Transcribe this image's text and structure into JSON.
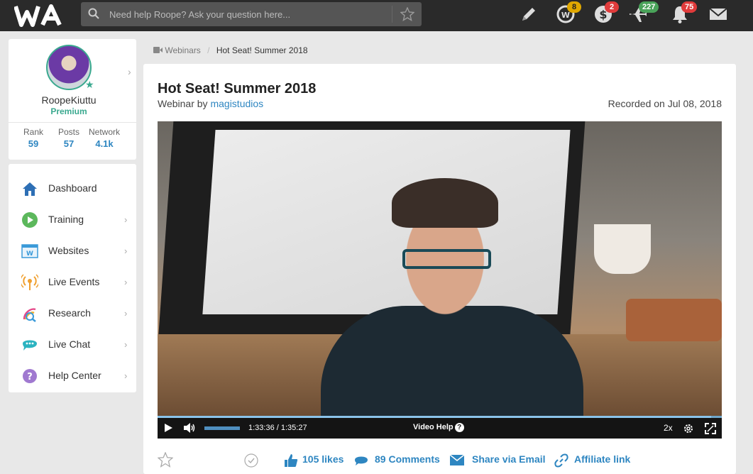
{
  "header": {
    "logo_text": "WA",
    "search": {
      "placeholder": "Need help Roope? Ask your question here..."
    },
    "icons": [
      {
        "name": "pencil-icon"
      },
      {
        "name": "wa-credits-icon",
        "badge": "8",
        "badge_color": "#e0a800"
      },
      {
        "name": "dollar-icon",
        "badge": "2",
        "badge_color": "#e03b3b"
      },
      {
        "name": "plane-icon",
        "badge": "227",
        "badge_color": "#4aa35a"
      },
      {
        "name": "bell-icon",
        "badge": "75",
        "badge_color": "#e03b3b"
      },
      {
        "name": "mail-icon"
      }
    ]
  },
  "profile": {
    "username": "RoopeKiuttu",
    "membership": "Premium",
    "stats": [
      {
        "label": "Rank",
        "value": "59"
      },
      {
        "label": "Posts",
        "value": "57"
      },
      {
        "label": "Network",
        "value": "4.1k"
      }
    ]
  },
  "sidebar": {
    "items": [
      {
        "label": "Dashboard",
        "icon": "home-icon",
        "has_chevron": false
      },
      {
        "label": "Training",
        "icon": "play-circle-icon",
        "has_chevron": true
      },
      {
        "label": "Websites",
        "icon": "website-icon",
        "has_chevron": true
      },
      {
        "label": "Live Events",
        "icon": "broadcast-icon",
        "has_chevron": true
      },
      {
        "label": "Research",
        "icon": "research-icon",
        "has_chevron": true
      },
      {
        "label": "Live Chat",
        "icon": "chat-icon",
        "has_chevron": true
      },
      {
        "label": "Help Center",
        "icon": "help-icon",
        "has_chevron": true
      }
    ]
  },
  "breadcrumb": {
    "parent": "Webinars",
    "separator": "/",
    "current": "Hot Seat! Summer 2018"
  },
  "main": {
    "title": "Hot Seat! Summer 2018",
    "subtitle_prefix": "Webinar by",
    "author": "magistudios",
    "recorded": "Recorded on Jul 08, 2018"
  },
  "player": {
    "time": "1:33:36 / 1:35:27",
    "progress_fraction": 0.981,
    "volume_fraction": 1.0,
    "video_help_label": "Video Help",
    "speed": "2x"
  },
  "actions": {
    "likes": "105 likes",
    "comments": "89 Comments",
    "share": "Share via Email",
    "affiliate": "Affiliate link"
  },
  "colors": {
    "accent": "#2e86c1",
    "premium": "#3aa98f",
    "topbar": "#2a2a2a"
  }
}
